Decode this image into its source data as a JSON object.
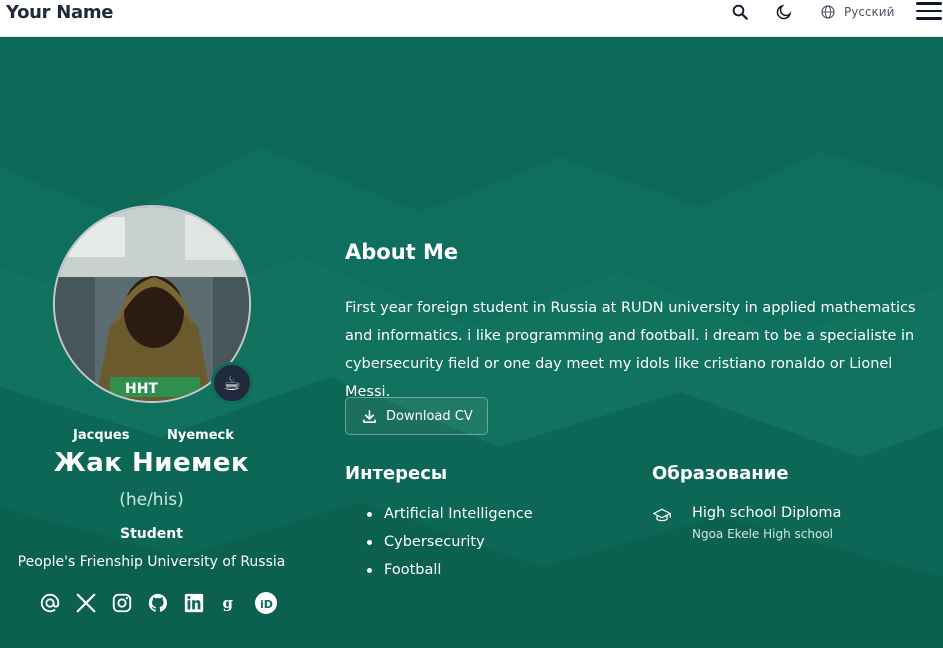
{
  "header": {
    "brand": "Your Name",
    "language_label": "Русский",
    "icons": [
      "search-icon",
      "moon-icon",
      "globe-icon",
      "menu-icon"
    ]
  },
  "colors": {
    "background": "#0e6a59",
    "navbar": "#ffffff",
    "text": "#ffffff"
  },
  "profile": {
    "first_name": "Jacques",
    "last_name": "Nyemeck",
    "full_name": "Жак Ниемек",
    "pronouns": "(he/his)",
    "role": "Student",
    "organization": "People's Frienship University of Russia",
    "status_emoji": "☕",
    "socials": [
      "email-icon",
      "x-twitter-icon",
      "instagram-icon",
      "github-icon",
      "linkedin-icon",
      "google-scholar-icon",
      "orcid-icon"
    ]
  },
  "about": {
    "title": "About Me",
    "text": "First year foreign student in Russia at RUDN university in applied mathematics and informatics. i like programming and football. i dream to be a specialiste in cybersecurity field or one day meet my idols like cristiano ronaldo or Lionel Messi.",
    "cv_label": "Download CV"
  },
  "interests": {
    "title": "Интересы",
    "items": [
      "Artificial Intelligence",
      "Cybersecurity",
      "Football"
    ]
  },
  "education": {
    "title": "Образование",
    "items": [
      {
        "degree": "High school Diploma",
        "school": "Ngoa Ekele High school"
      }
    ]
  }
}
